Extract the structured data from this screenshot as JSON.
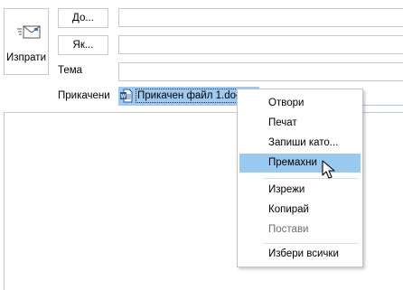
{
  "header": {
    "send_label": "Изпрати",
    "to_button": "До...",
    "cc_button": "Як...",
    "subject_label": "Тема",
    "attached_label": "Прикачени"
  },
  "fields": {
    "to_value": "",
    "cc_value": "",
    "subject_value": ""
  },
  "attachment": {
    "file_name": "Прикачен файл 1.doc",
    "icon": "word-document-icon"
  },
  "context_menu": {
    "items": [
      {
        "label": "Отвори",
        "enabled": true,
        "highlighted": false
      },
      {
        "label": "Печат",
        "enabled": true,
        "highlighted": false
      },
      {
        "label": "Запиши като...",
        "enabled": true,
        "highlighted": false
      },
      {
        "label": "Премахни",
        "enabled": true,
        "highlighted": true
      },
      {
        "label": "Изрежи",
        "enabled": true,
        "highlighted": false
      },
      {
        "label": "Копирай",
        "enabled": true,
        "highlighted": false
      },
      {
        "label": "Постави",
        "enabled": false,
        "highlighted": false
      },
      {
        "label": "Избери всички",
        "enabled": true,
        "highlighted": false
      }
    ]
  },
  "colors": {
    "selection": "#9fc9f1",
    "menu_highlight": "#99c9ef",
    "border": "#c8c8c8",
    "disabled_text": "#6d6d6d"
  }
}
